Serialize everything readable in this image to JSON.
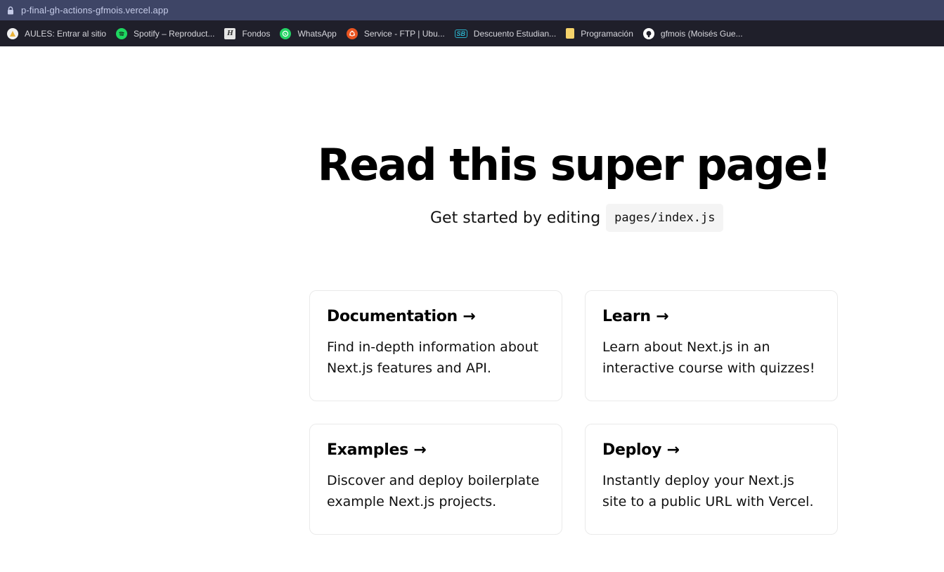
{
  "browser": {
    "url": "p-final-gh-actions-gfmois.vercel.app",
    "bookmarks": [
      {
        "label": "AULES: Entrar al sitio",
        "icon": "aules-icon",
        "color": "#e8b23a"
      },
      {
        "label": "Spotify – Reproduct...",
        "icon": "spotify-icon",
        "color": "#1ed760"
      },
      {
        "label": "Fondos",
        "icon": "fondos-icon",
        "color": "#e6e6e6"
      },
      {
        "label": "WhatsApp",
        "icon": "whatsapp-icon",
        "color": "#25d366"
      },
      {
        "label": "Service - FTP | Ubu...",
        "icon": "ubuntu-icon",
        "color": "#e95420"
      },
      {
        "label": "Descuento Estudian...",
        "icon": "sb-icon",
        "color": "#2ab0c9"
      },
      {
        "label": "Programación",
        "icon": "folder-icon",
        "color": "#f5d36b"
      },
      {
        "label": "gfmois (Moisés Gue...",
        "icon": "github-icon",
        "color": "#ffffff"
      }
    ]
  },
  "page": {
    "title": "Read this super page!",
    "subtitle": "Get started by editing",
    "code": "pages/index.js",
    "cards": [
      {
        "title": "Documentation →",
        "text": "Find in-depth information about Next.js features and API."
      },
      {
        "title": "Learn →",
        "text": "Learn about Next.js in an interactive course with quizzes!"
      },
      {
        "title": "Examples →",
        "text": "Discover and deploy boilerplate example Next.js projects."
      },
      {
        "title": "Deploy →",
        "text": "Instantly deploy your Next.js site to a public URL with Vercel."
      }
    ]
  }
}
